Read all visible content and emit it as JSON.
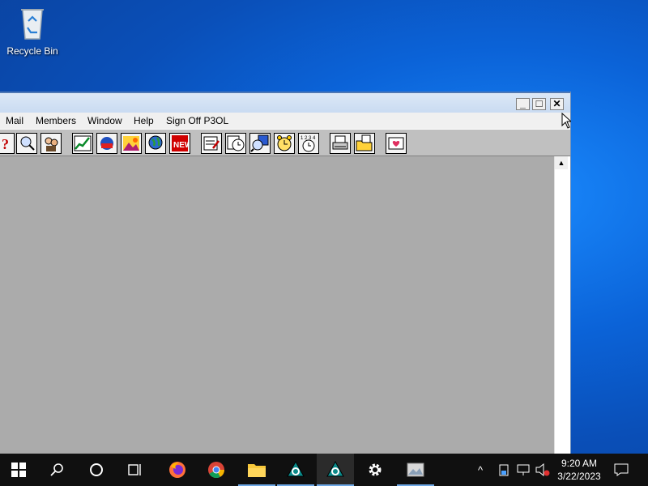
{
  "desktop": {
    "recycle_bin_label": "Recycle Bin"
  },
  "window": {
    "menu": [
      "Mail",
      "Members",
      "Window",
      "Help",
      "Sign Off P3OL"
    ],
    "controls": {
      "minimize": "_",
      "maximize": "□",
      "close": "✕"
    },
    "toolbar_icons": [
      "help-icon",
      "find-icon",
      "member-directory-icon",
      "stock-chart-icon",
      "keyword-icon",
      "picture-icon",
      "globe-icon",
      "news-icon",
      "compose-mail-icon",
      "schedule-icon",
      "people-search-icon",
      "alarm-clock-icon",
      "stopwatch-icon",
      "print-icon",
      "open-folder-icon",
      "favorites-icon"
    ]
  },
  "taskbar": {
    "time": "9:20 AM",
    "date": "3/22/2023",
    "apps": [
      "start-icon",
      "search-icon",
      "cortana-icon",
      "task-view-icon",
      "firefox-icon",
      "chrome-icon",
      "file-explorer-icon",
      "aol-icon",
      "aol-icon",
      "settings-icon",
      "photos-icon"
    ],
    "tray_chevron": "^"
  },
  "colors": {
    "desktop": "#0b63d8",
    "client_area": "#ababab",
    "taskbar": "#101010"
  }
}
